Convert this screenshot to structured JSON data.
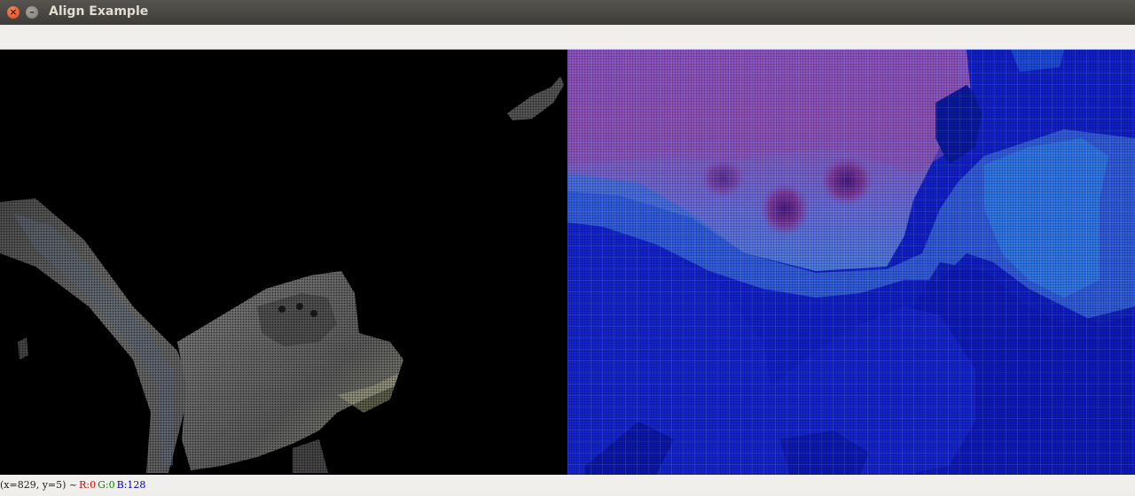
{
  "window": {
    "title": "Align Example",
    "close_glyph": "×",
    "minimize_glyph": "–"
  },
  "status": {
    "coords": "(x=829, y=5) ~",
    "r": "R:0",
    "g": "G:0",
    "b": "B:128",
    "colors": {
      "r": "#e00000",
      "g": "#008800",
      "b": "#0000cc"
    }
  },
  "panes": {
    "left": "aligned-color-image",
    "right": "depth-colormap-image"
  }
}
